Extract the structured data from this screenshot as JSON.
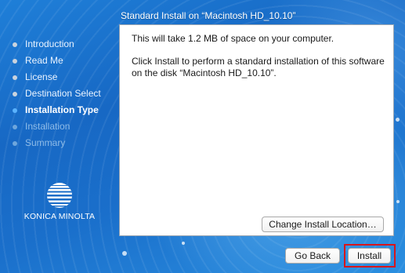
{
  "window": {
    "panel_title": "Standard Install on “Macintosh HD_10.10”"
  },
  "sidebar": {
    "steps": [
      {
        "label": "Introduction",
        "state": "done"
      },
      {
        "label": "Read Me",
        "state": "done"
      },
      {
        "label": "License",
        "state": "done"
      },
      {
        "label": "Destination Select",
        "state": "done"
      },
      {
        "label": "Installation Type",
        "state": "current"
      },
      {
        "label": "Installation",
        "state": "future"
      },
      {
        "label": "Summary",
        "state": "future"
      }
    ],
    "logo_icon": "konica-minolta-globe-icon",
    "logo_text": "KONICA MINOLTA"
  },
  "content": {
    "space_message": "This will take 1.2 MB of space on your computer.",
    "install_message": "Click Install to perform a standard installation of this software on the disk “Macintosh HD_10.10”.",
    "change_location_label": "Change Install Location…"
  },
  "footer": {
    "back_label": "Go Back",
    "install_label": "Install"
  },
  "colors": {
    "accent_blue": "#1768c4",
    "highlight_red": "#d9151b",
    "current_step_bullet": "#5ab3ff"
  }
}
